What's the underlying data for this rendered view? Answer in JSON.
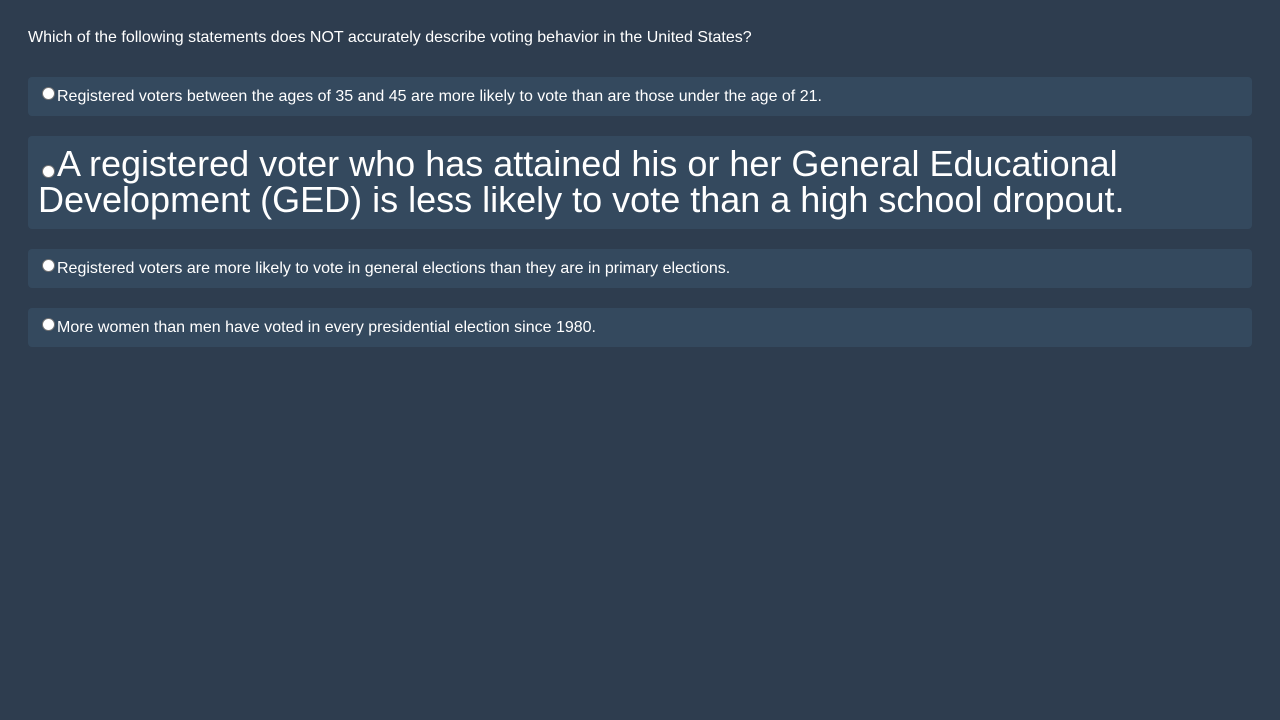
{
  "question": {
    "text": "Which of the following statements does NOT accurately describe voting behavior in the United States?"
  },
  "options": [
    {
      "text": "Registered voters between the ages of 35 and 45 are more likely to vote than are those under the age of 21.",
      "selected": false
    },
    {
      "text": "A registered voter who has attained his or her General Educational Development (GED) is less likely to vote than a high school dropout.",
      "selected": false
    },
    {
      "text": "Registered voters are more likely to vote in general elections than they are in primary elections.",
      "selected": false
    },
    {
      "text": "More women than men have voted in every presidential election since 1980.",
      "selected": false
    }
  ],
  "colors": {
    "background": "#2e3d4f",
    "option_background": "#34495e",
    "text": "#ffffff"
  }
}
